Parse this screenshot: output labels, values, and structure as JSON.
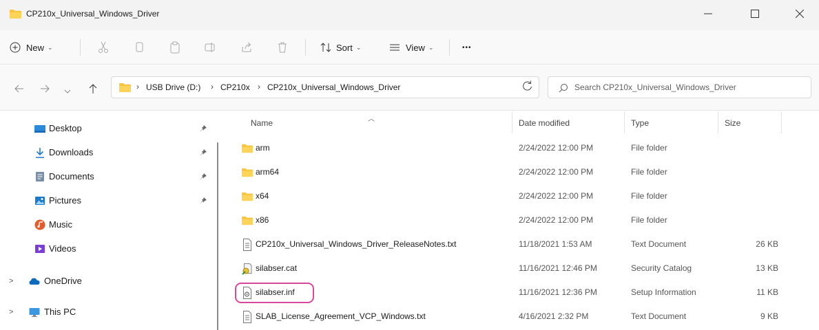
{
  "window": {
    "title": "CP210x_Universal_Windows_Driver",
    "folder_icon": "folder-icon",
    "controls": {
      "minimize": "minimize-icon",
      "maximize": "maximize-icon",
      "close": "close-icon"
    }
  },
  "toolbar": {
    "new_label": "New",
    "sort_label": "Sort",
    "view_label": "View",
    "more_label": "•••",
    "icons": [
      "plus-icon",
      "cut-icon",
      "copy-icon",
      "paste-icon",
      "rename-icon",
      "share-icon",
      "delete-icon",
      "sort-icon",
      "view-icon"
    ]
  },
  "address": {
    "crumbs": [
      "USB Drive (D:)",
      "CP210x",
      "CP210x_Universal_Windows_Driver"
    ],
    "separator": "›",
    "search_placeholder": "Search CP210x_Universal_Windows_Driver"
  },
  "sidebar": {
    "items": [
      {
        "label": "Desktop",
        "icon": "desktop-icon",
        "pinned": true
      },
      {
        "label": "Downloads",
        "icon": "download-icon",
        "pinned": true
      },
      {
        "label": "Documents",
        "icon": "document-icon",
        "pinned": true
      },
      {
        "label": "Pictures",
        "icon": "pictures-icon",
        "pinned": true
      },
      {
        "label": "Music",
        "icon": "music-icon",
        "pinned": false
      },
      {
        "label": "Videos",
        "icon": "videos-icon",
        "pinned": false
      },
      {
        "label": "OneDrive",
        "icon": "cloud-icon",
        "pinned": false
      },
      {
        "label": "This PC",
        "icon": "pc-icon",
        "pinned": false
      }
    ]
  },
  "files": {
    "columns": [
      "Name",
      "Date modified",
      "Type",
      "Size"
    ],
    "rows": [
      {
        "name": "arm",
        "date": "2/24/2022 12:00 PM",
        "type": "File folder",
        "size": "",
        "icon": "folder-icon"
      },
      {
        "name": "arm64",
        "date": "2/24/2022 12:00 PM",
        "type": "File folder",
        "size": "",
        "icon": "folder-icon"
      },
      {
        "name": "x64",
        "date": "2/24/2022 12:00 PM",
        "type": "File folder",
        "size": "",
        "icon": "folder-icon"
      },
      {
        "name": "x86",
        "date": "2/24/2022 12:00 PM",
        "type": "File folder",
        "size": "",
        "icon": "folder-icon"
      },
      {
        "name": "CP210x_Universal_Windows_Driver_ReleaseNotes.txt",
        "date": "11/18/2021 1:53 AM",
        "type": "Text Document",
        "size": "26 KB",
        "icon": "text-file-icon"
      },
      {
        "name": "silabser.cat",
        "date": "11/16/2021 12:46 PM",
        "type": "Security Catalog",
        "size": "13 KB",
        "icon": "security-catalog-icon"
      },
      {
        "name": "silabser.inf",
        "date": "11/16/2021 12:36 PM",
        "type": "Setup Information",
        "size": "11 KB",
        "icon": "setup-information-icon"
      },
      {
        "name": "SLAB_License_Agreement_VCP_Windows.txt",
        "date": "4/16/2021 2:32 PM",
        "type": "Text Document",
        "size": "9 KB",
        "icon": "text-file-icon"
      }
    ]
  },
  "colors": {
    "folder": "#f8c43d",
    "highlight": "#d9479b",
    "desktop": "#2d8ad8",
    "onedrive": "#0f6cbd"
  }
}
